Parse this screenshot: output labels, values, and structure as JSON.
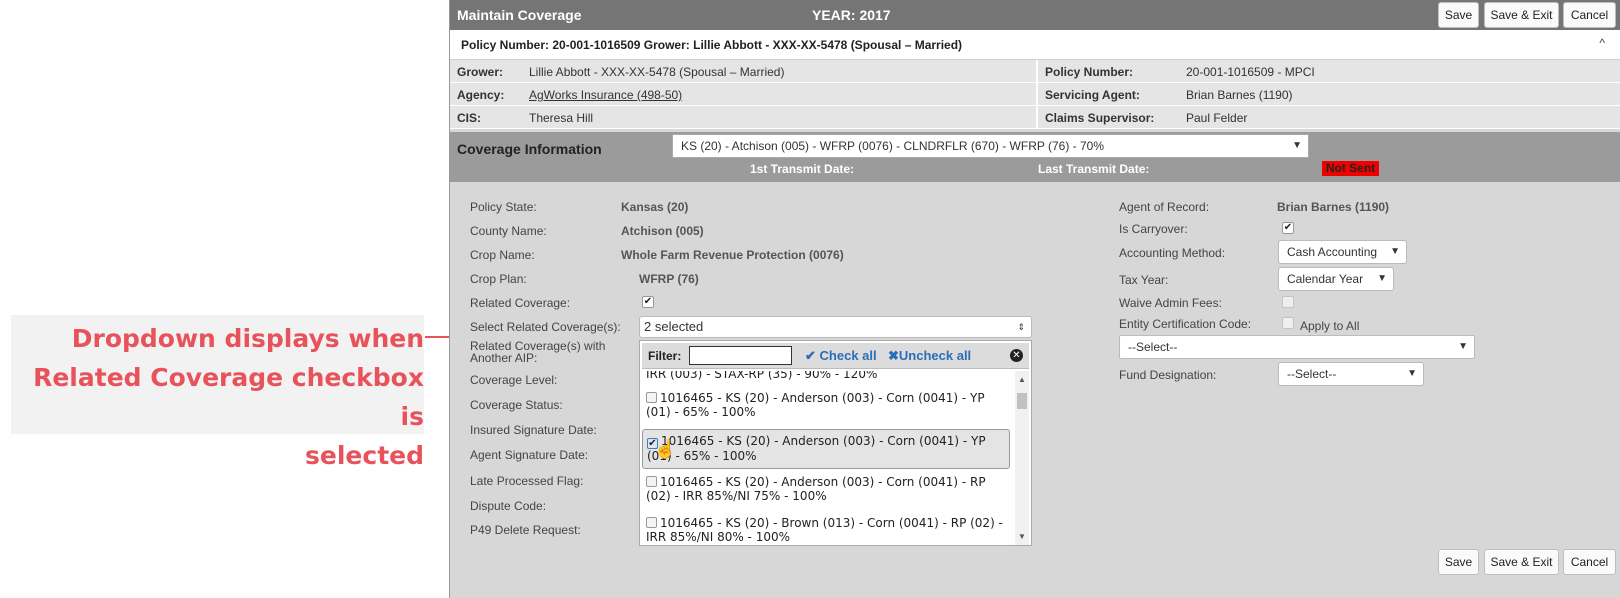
{
  "callout": {
    "text_line1": "Dropdown displays when",
    "text_line2": "Related Coverage checkbox is",
    "text_line3": "selected"
  },
  "titlebar": {
    "title": "Maintain Coverage",
    "year": "YEAR: 2017",
    "save_label": "Save",
    "save_exit_label": "Save & Exit",
    "cancel_label": "Cancel"
  },
  "policy_header": {
    "text": "Policy Number: 20-001-1016509 Grower: Lillie Abbott - XXX-XX-5478 (Spousal – Married)",
    "collapse_icon": "^"
  },
  "info": {
    "grower_label": "Grower:",
    "grower_value": "Lillie Abbott - XXX-XX-5478 (Spousal – Married)",
    "agency_label": "Agency:",
    "agency_value": "AgWorks Insurance (498-50)",
    "cis_label": "CIS:",
    "cis_value": "Theresa Hill",
    "policy_number_label": "Policy Number:",
    "policy_number_value": "20-001-1016509 - MPCI",
    "servicing_agent_label": "Servicing Agent:",
    "servicing_agent_value": "Brian Barnes (1190)",
    "claims_supervisor_label": "Claims Supervisor:",
    "claims_supervisor_value": "Paul Felder"
  },
  "coverage_bar": {
    "title": "Coverage Information",
    "selected_coverage": "KS (20) - Atchison (005) - WFRP (0076) - CLNDRFLR (670) - WFRP (76) - 70%",
    "first_transmit_label": "1st Transmit Date:",
    "last_transmit_label": "Last Transmit Date:",
    "status_badge": "Not Sent",
    "status_color": "#f20000"
  },
  "left_form": {
    "policy_state_label": "Policy State:",
    "policy_state_value": "Kansas (20)",
    "county_name_label": "County Name:",
    "county_name_value": "Atchison (005)",
    "crop_name_label": "Crop Name:",
    "crop_name_value": "Whole Farm Revenue Protection (0076)",
    "crop_plan_label": "Crop Plan:",
    "crop_plan_value": "WFRP (76)",
    "related_coverage_label": "Related Coverage:",
    "select_related_label": "Select Related Coverage(s):",
    "related_with_aip_label": "Related Coverage(s) with Another AIP:",
    "coverage_level_label": "Coverage Level:",
    "coverage_status_label": "Coverage Status:",
    "insured_sig_label": "Insured Signature Date:",
    "agent_sig_label": "Agent Signature Date:",
    "late_processed_label": "Late Processed Flag:",
    "dispute_code_label": "Dispute Code:",
    "p49_label": "P49 Delete Request:"
  },
  "multiselect": {
    "summary": "2 selected",
    "filter_label": "Filter:",
    "check_all": "Check all",
    "uncheck_all": "Uncheck all",
    "items": [
      {
        "text": "IRR (003) - STAX-RP (35) - 90% - 120%",
        "checked": false
      },
      {
        "text": "1016465 - KS (20) - Anderson (003) - Corn (0041) - YP (01) - 65% - 100%",
        "checked": false
      },
      {
        "text": "1016465 - KS (20) - Anderson (003) - Corn (0041) - YP (01) - 65% - 100%",
        "checked": true
      },
      {
        "text": "1016465 - KS (20) - Anderson (003) - Corn (0041) - RP (02) - IRR 85%/NI 75% - 100%",
        "checked": false
      },
      {
        "text": "1016465 - KS (20) - Brown (013) - Corn (0041) - RP (02) - IRR 85%/NI 80% - 100%",
        "checked": false
      }
    ]
  },
  "right_form": {
    "agent_of_record_label": "Agent of Record:",
    "agent_of_record_value": "Brian Barnes (1190)",
    "is_carryover_label": "Is Carryover:",
    "accounting_method_label": "Accounting Method:",
    "accounting_method_value": "Cash Accounting",
    "tax_year_label": "Tax Year:",
    "tax_year_value": "Calendar Year",
    "waive_admin_label": "Waive Admin Fees:",
    "entity_cert_label": "Entity Certification Code:",
    "apply_to_all_label": "Apply to All",
    "entity_cert_value": "--Select--",
    "fund_designation_label": "Fund Designation:",
    "fund_designation_value": "--Select--"
  },
  "footer": {
    "save_label": "Save",
    "save_exit_label": "Save & Exit",
    "cancel_label": "Cancel"
  }
}
